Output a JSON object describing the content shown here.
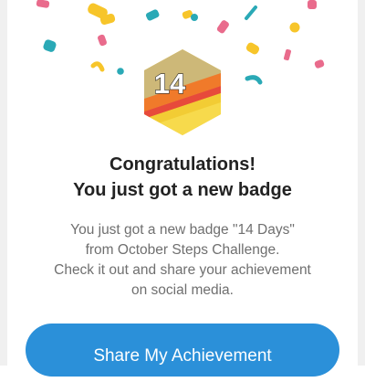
{
  "dialog": {
    "title_line1": "Congratulations!",
    "title_line2": "You just got a new badge",
    "body_lines": [
      "You just got a new badge \"14 Days\"",
      "from October Steps Challenge.",
      "Check it out and share your achievement",
      "on social media."
    ],
    "badge_number": "14",
    "cta_label": "Share My Achievement"
  },
  "colors": {
    "accent": "#2b90d9",
    "badge_top": "#cdb878",
    "badge_orange": "#f07a2a",
    "badge_yellow": "#f2cc34",
    "badge_red": "#e74a3b",
    "confetti": [
      "#f7c52a",
      "#2aa9b6",
      "#e96b8c"
    ]
  }
}
